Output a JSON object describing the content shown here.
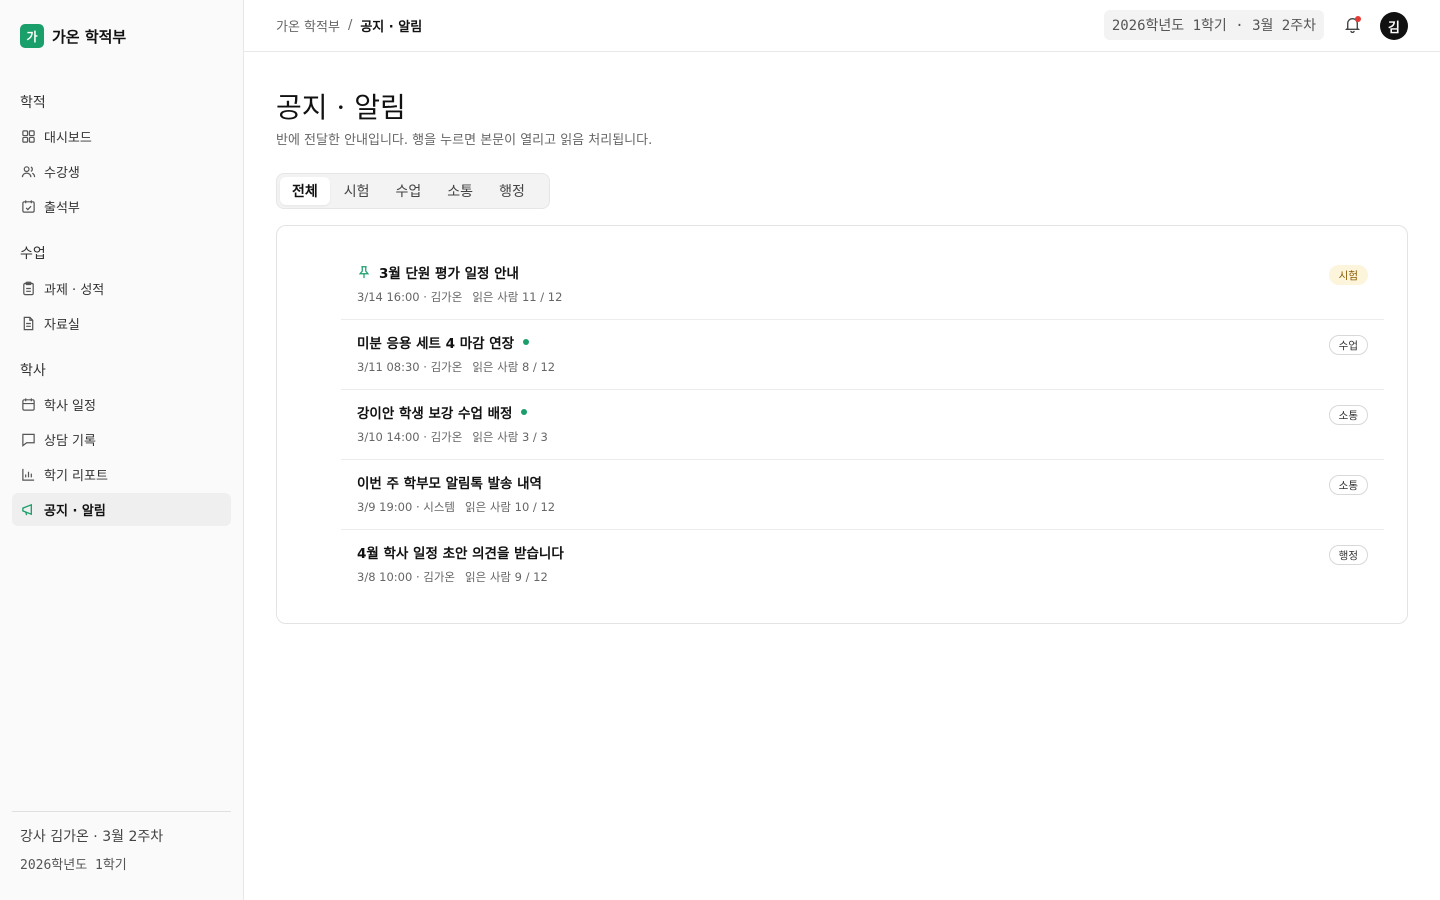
{
  "brand": {
    "logo_text": "가",
    "name": "가온 학적부"
  },
  "sidebar": {
    "sections": [
      {
        "title": "학적",
        "items": [
          {
            "label": "대시보드",
            "icon": "dashboard-icon"
          },
          {
            "label": "수강생",
            "icon": "users-icon"
          },
          {
            "label": "출석부",
            "icon": "calendar-check-icon"
          }
        ]
      },
      {
        "title": "수업",
        "items": [
          {
            "label": "과제 · 성적",
            "icon": "clipboard-icon"
          },
          {
            "label": "자료실",
            "icon": "file-icon"
          }
        ]
      },
      {
        "title": "학사",
        "items": [
          {
            "label": "학사 일정",
            "icon": "calendar-icon"
          },
          {
            "label": "상담 기록",
            "icon": "chat-icon"
          },
          {
            "label": "학기 리포트",
            "icon": "bar-chart-icon"
          },
          {
            "label": "공지 · 알림",
            "icon": "megaphone-icon",
            "active": true
          }
        ]
      }
    ],
    "footer": {
      "line1": "강사 김가온 · 3월 2주차",
      "line2": "2026학년도 1학기"
    }
  },
  "topbar": {
    "breadcrumb_root": "가온 학적부",
    "breadcrumb_sep": "/",
    "breadcrumb_current": "공지 · 알림",
    "term": "2026학년도 1학기 · 3월 2주차",
    "avatar_text": "김"
  },
  "page": {
    "title": "공지 · 알림",
    "description": "반에 전달한 안내입니다. 행을 누르면 본문이 열리고 읽음 처리됩니다."
  },
  "tabs": [
    {
      "label": "전체",
      "active": true
    },
    {
      "label": "시험"
    },
    {
      "label": "수업"
    },
    {
      "label": "소통"
    },
    {
      "label": "행정"
    }
  ],
  "notices": [
    {
      "title": "3월 단원 평가 일정 안내",
      "pinned": true,
      "unread": false,
      "meta": "3/14 16:00 · 김가온",
      "reads": "읽은 사람 11 / 12",
      "category": "시험"
    },
    {
      "title": "미분 응용 세트 4 마감 연장",
      "pinned": false,
      "unread": true,
      "meta": "3/11 08:30 · 김가온",
      "reads": "읽은 사람 8 / 12",
      "category": "수업"
    },
    {
      "title": "강이안 학생 보강 수업 배정",
      "pinned": false,
      "unread": true,
      "meta": "3/10 14:00 · 김가온",
      "reads": "읽은 사람 3 / 3",
      "category": "소통"
    },
    {
      "title": "이번 주 학부모 알림톡 발송 내역",
      "pinned": false,
      "unread": false,
      "meta": "3/9 19:00 · 시스템",
      "reads": "읽은 사람 10 / 12",
      "category": "소통"
    },
    {
      "title": "4월 학사 일정 초안 의견을 받습니다",
      "pinned": false,
      "unread": false,
      "meta": "3/8 10:00 · 김가온",
      "reads": "읽은 사람 9 / 12",
      "category": "행정"
    }
  ],
  "colors": {
    "accent": "#1a9e6a",
    "notification_dot": "#e53935",
    "exam_badge_bg": "#fdf4dc"
  }
}
